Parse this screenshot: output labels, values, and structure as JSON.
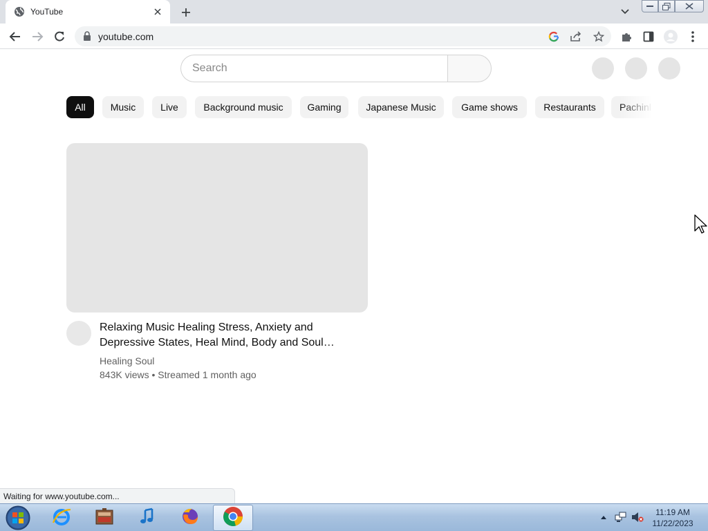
{
  "browser": {
    "tab_title": "YouTube",
    "url": "youtube.com",
    "status_text": "Waiting for www.youtube.com..."
  },
  "youtube": {
    "search_placeholder": "Search",
    "chips": [
      "All",
      "Music",
      "Live",
      "Background music",
      "Gaming",
      "Japanese Music",
      "Game shows",
      "Restaurants",
      "Pachinko"
    ],
    "active_chip": "All",
    "video": {
      "title": "Relaxing Music Healing Stress, Anxiety and Depressive States, Heal Mind, Body and Soul…",
      "channel": "Healing Soul",
      "meta": "843K views • Streamed 1 month ago"
    }
  },
  "taskbar": {
    "apps": [
      "windows-explorer",
      "internet-explorer",
      "media-center",
      "itunes",
      "firefox",
      "chrome"
    ],
    "time": "11:19 AM",
    "date": "11/22/2023"
  },
  "colors": {
    "chip_active_bg": "#0f0f0f",
    "chip_bg": "#f2f2f2",
    "placeholder_bg": "#e5e5e5",
    "meta_text": "#606060",
    "taskbar_bg": "#a9c3e0"
  }
}
